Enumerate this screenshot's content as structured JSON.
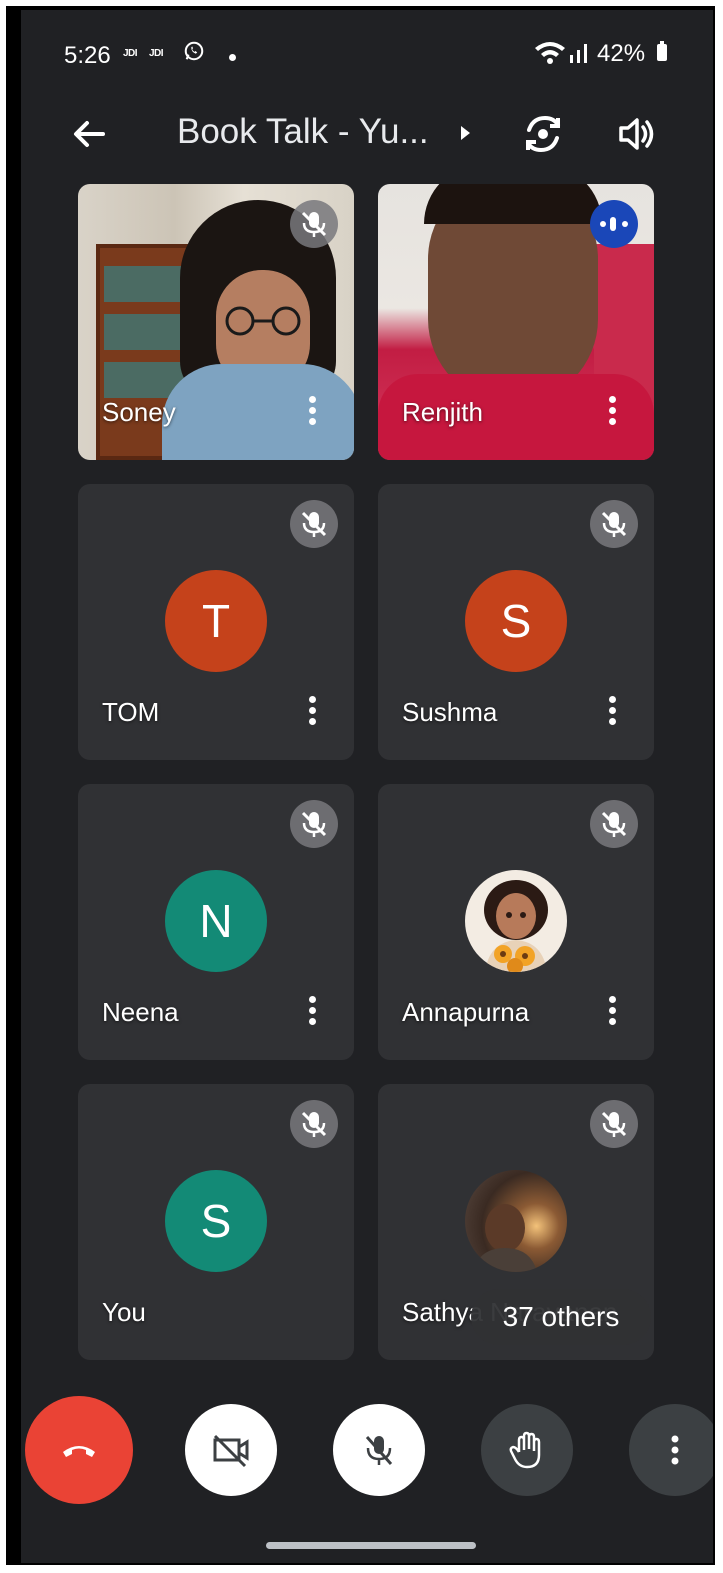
{
  "status_bar": {
    "time": "5:26",
    "carrier_1": "JDI",
    "carrier_2": "JDI",
    "battery": "42%",
    "icons": [
      "whatsapp-icon",
      "wifi-icon",
      "signal-icon",
      "battery-icon"
    ]
  },
  "header": {
    "title": "Book Talk - Yu...",
    "icons": [
      "back-arrow-icon",
      "caret-right-icon",
      "flip-camera-icon",
      "speaker-icon"
    ]
  },
  "participants": [
    {
      "name": "Soney",
      "type": "video",
      "muted": true
    },
    {
      "name": "Renjith",
      "type": "video",
      "muted": false,
      "speaking": true
    },
    {
      "name": "TOM",
      "initial": "T",
      "avatar_color": "#c5421b",
      "muted": true
    },
    {
      "name": "Sushma",
      "initial": "S",
      "avatar_color": "#c5421b",
      "muted": true
    },
    {
      "name": "Neena",
      "initial": "N",
      "avatar_color": "#138a76",
      "muted": true
    },
    {
      "name": "Annapurna",
      "type": "illustration-avatar",
      "muted": true
    },
    {
      "name": "You",
      "initial": "S",
      "avatar_color": "#138a76",
      "muted": true
    },
    {
      "name": "Sathya Narayanan",
      "type": "photo-avatar",
      "muted": true
    }
  ],
  "others_pill": "37 others",
  "controls": {
    "end_call": "end-call-icon",
    "camera": "camera-off-icon",
    "microphone": "mic-off-icon",
    "raise_hand": "raise-hand-icon",
    "more": "more-vert-icon"
  },
  "colors": {
    "background": "#202124",
    "tile": "#3c4043",
    "end_call": "#ea4335",
    "speaking": "#1a47b8"
  }
}
